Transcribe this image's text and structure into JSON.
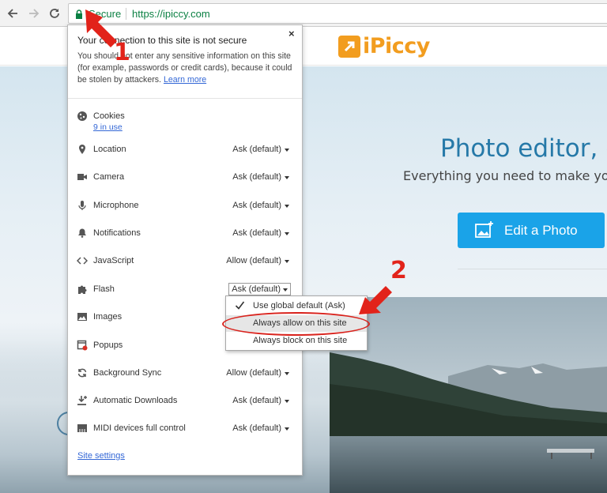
{
  "browser": {
    "secure_label": "Secure",
    "url": "https://ipiccy.com"
  },
  "site": {
    "logo_text": "iPiccy",
    "hero_title": "Photo editor, de",
    "hero_subtitle": "Everything you need to make your p",
    "edit_button_label": "Edit a Photo"
  },
  "popup": {
    "title": "Your connection to this site is not secure",
    "description": "You should not enter any sensitive information on this site (for example, passwords or credit cards), because it could be stolen by attackers.",
    "learn_more": "Learn more",
    "close_label": "×",
    "cookies": {
      "label": "Cookies",
      "sub": "9 in use"
    },
    "permissions": [
      {
        "label": "Location",
        "value": "Ask (default)",
        "icon": "location-pin-icon"
      },
      {
        "label": "Camera",
        "value": "Ask (default)",
        "icon": "camera-icon"
      },
      {
        "label": "Microphone",
        "value": "Ask (default)",
        "icon": "microphone-icon"
      },
      {
        "label": "Notifications",
        "value": "Ask (default)",
        "icon": "bell-icon"
      },
      {
        "label": "JavaScript",
        "value": "Allow (default)",
        "icon": "code-icon"
      },
      {
        "label": "Flash",
        "value": "Ask (default)",
        "icon": "puzzle-icon"
      },
      {
        "label": "Images",
        "value": "",
        "icon": "image-icon"
      },
      {
        "label": "Popups",
        "value": "",
        "icon": "popup-blocked-icon"
      },
      {
        "label": "Background Sync",
        "value": "Allow (default)",
        "icon": "sync-icon"
      },
      {
        "label": "Automatic Downloads",
        "value": "Ask (default)",
        "icon": "download-icon"
      },
      {
        "label": "MIDI devices full control",
        "value": "Ask (default)",
        "icon": "piano-icon"
      }
    ],
    "site_settings": "Site settings"
  },
  "flash_dropdown": {
    "options": [
      {
        "label": "Use global default (Ask)",
        "checked": true
      },
      {
        "label": "Always allow on this site",
        "checked": false
      },
      {
        "label": "Always block on this site",
        "checked": false
      }
    ]
  },
  "annotations": {
    "step1": "1",
    "step2": "2",
    "color": "#e2231a"
  }
}
